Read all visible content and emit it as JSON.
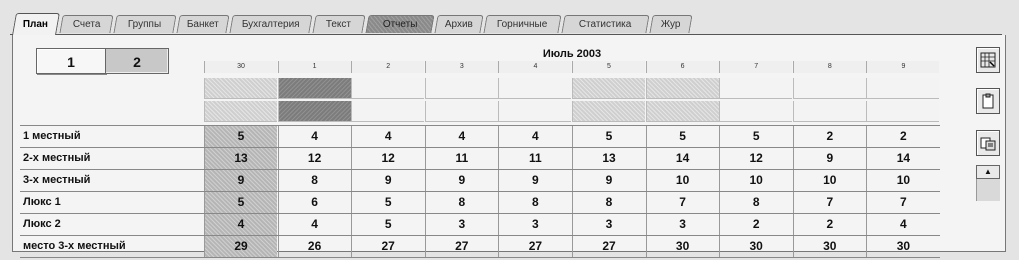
{
  "tabs": [
    {
      "label": "План",
      "active": true
    },
    {
      "label": "Счета"
    },
    {
      "label": "Группы"
    },
    {
      "label": "Банкет"
    },
    {
      "label": "Бухгалтерия"
    },
    {
      "label": "Текст"
    },
    {
      "label": "Отчеты",
      "dark": true
    },
    {
      "label": "Архив"
    },
    {
      "label": "Горничные"
    },
    {
      "label": "Статистика"
    },
    {
      "label": "Жур"
    }
  ],
  "pager": {
    "page1": "1",
    "page2": "2"
  },
  "calendar": {
    "month_title": "Июль 2003",
    "days": [
      "30",
      "1",
      "2",
      "3",
      "4",
      "5",
      "6",
      "7",
      "8",
      "9"
    ]
  },
  "occupancy": {
    "row1": [
      "light",
      "dark",
      "",
      "",
      "",
      "light",
      "light",
      "",
      "",
      ""
    ],
    "row2": [
      "light",
      "dark",
      "",
      "",
      "",
      "light",
      "light",
      "",
      "",
      ""
    ]
  },
  "rooms": [
    {
      "label": "1 местный",
      "values": [
        "5",
        "4",
        "4",
        "4",
        "4",
        "5",
        "5",
        "5",
        "2",
        "2"
      ]
    },
    {
      "label": "2-х местный",
      "values": [
        "13",
        "12",
        "12",
        "11",
        "11",
        "13",
        "14",
        "12",
        "9",
        "14"
      ]
    },
    {
      "label": "3-х местный",
      "values": [
        "9",
        "8",
        "9",
        "9",
        "9",
        "9",
        "10",
        "10",
        "10",
        "10"
      ]
    },
    {
      "label": "Люкс 1",
      "values": [
        "5",
        "6",
        "5",
        "8",
        "8",
        "8",
        "7",
        "8",
        "7",
        "7"
      ]
    },
    {
      "label": "Люкс 2",
      "values": [
        "4",
        "4",
        "5",
        "3",
        "3",
        "3",
        "3",
        "2",
        "2",
        "4"
      ]
    },
    {
      "label": "место 3-х местный",
      "values": [
        "29",
        "26",
        "27",
        "27",
        "27",
        "27",
        "30",
        "30",
        "30",
        "30"
      ]
    }
  ],
  "toolbar": {
    "icons": [
      "grid-save-icon",
      "clipboard-icon",
      "copy-calendar-icon"
    ],
    "scroll_up_glyph": "▲"
  }
}
